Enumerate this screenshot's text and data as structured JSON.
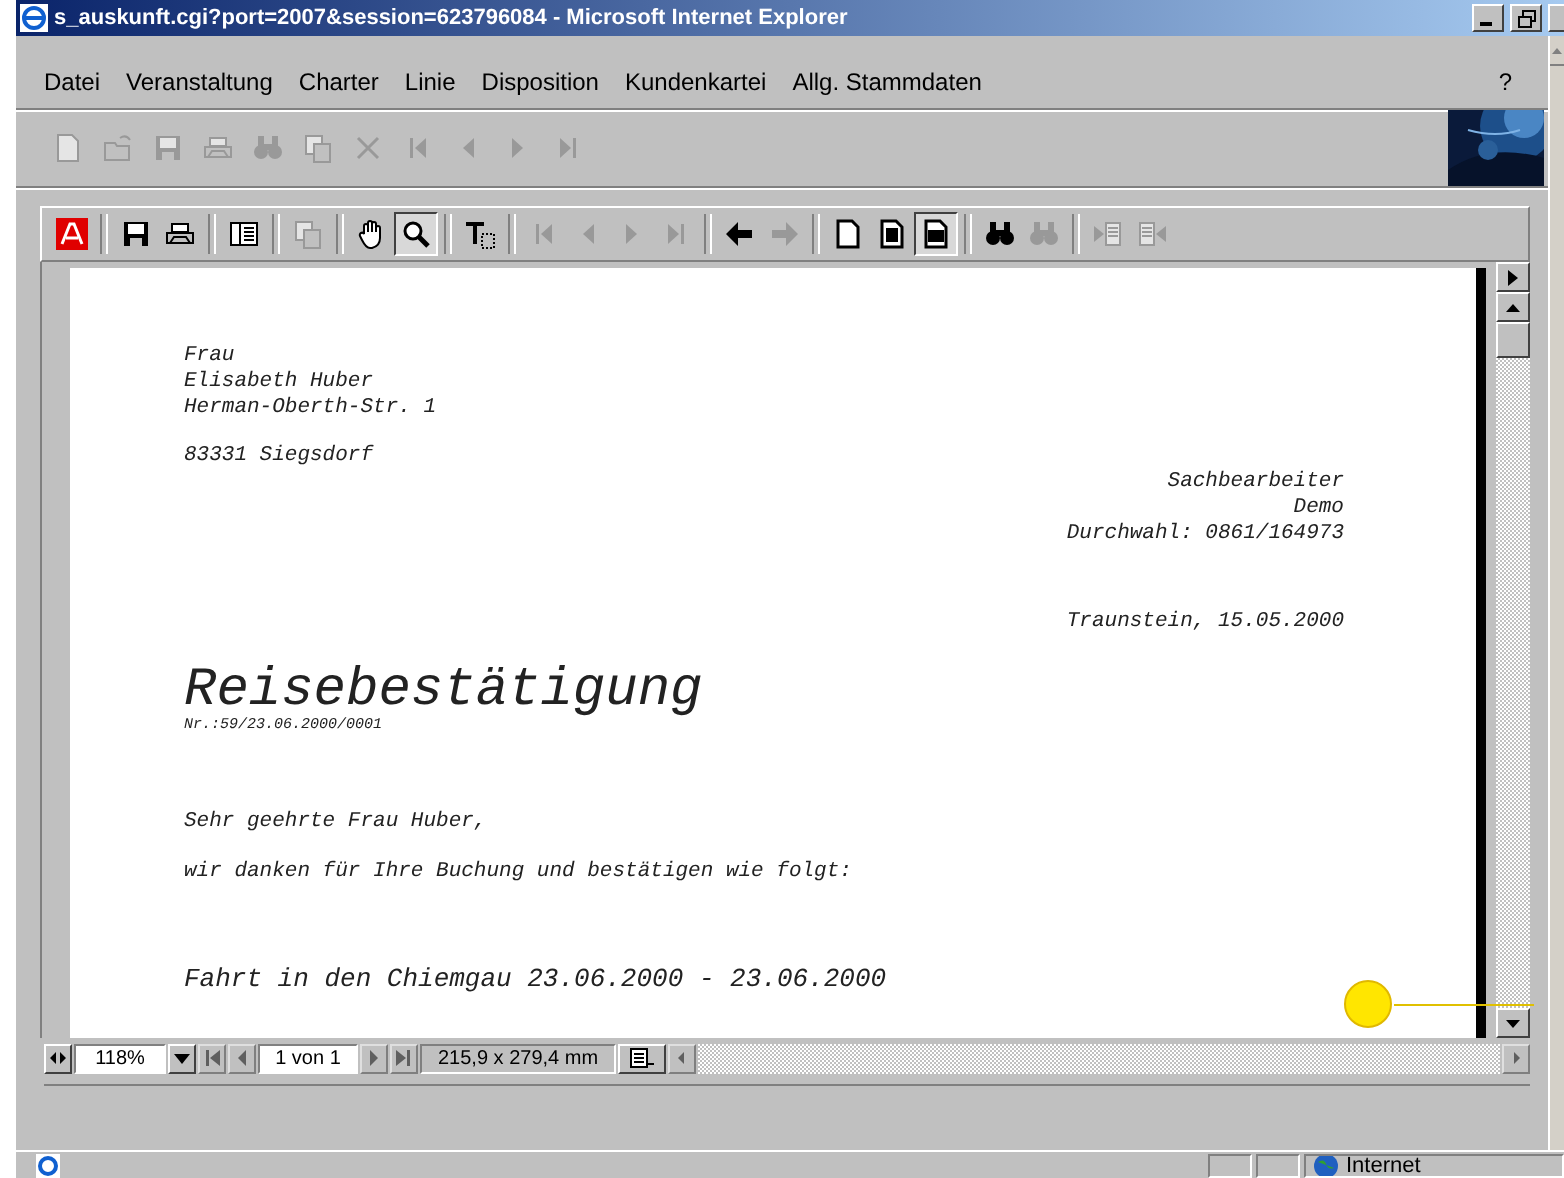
{
  "window": {
    "title": "s_auskunft.cgi?port=2007&session=623796084 - Microsoft Internet Explorer"
  },
  "menu": [
    "Datei",
    "Veranstaltung",
    "Charter",
    "Linie",
    "Disposition",
    "Kundenkartei",
    "Allg. Stammdaten"
  ],
  "help": "?",
  "toolbar": [
    {
      "kind": "new",
      "disabled": true
    },
    {
      "kind": "open",
      "disabled": true
    },
    {
      "kind": "save",
      "disabled": true
    },
    {
      "kind": "print",
      "disabled": true
    },
    {
      "kind": "find",
      "disabled": true
    },
    {
      "kind": "copy",
      "disabled": true
    },
    {
      "kind": "delete",
      "disabled": true
    },
    {
      "kind": "first",
      "disabled": true
    },
    {
      "kind": "prev",
      "disabled": true
    },
    {
      "kind": "next",
      "disabled": true
    },
    {
      "kind": "last",
      "disabled": true
    }
  ],
  "viewer_toolbar": [
    {
      "kind": "logo",
      "disabled": false,
      "selected": false
    },
    {
      "kind": "sep"
    },
    {
      "kind": "save",
      "disabled": false,
      "selected": false
    },
    {
      "kind": "print",
      "disabled": false,
      "selected": false
    },
    {
      "kind": "sep"
    },
    {
      "kind": "panel",
      "disabled": false,
      "selected": false
    },
    {
      "kind": "sep"
    },
    {
      "kind": "copy",
      "disabled": true,
      "selected": false
    },
    {
      "kind": "sep"
    },
    {
      "kind": "hand",
      "disabled": false,
      "selected": false
    },
    {
      "kind": "zoom",
      "disabled": false,
      "selected": true
    },
    {
      "kind": "sep"
    },
    {
      "kind": "text",
      "disabled": false,
      "selected": false
    },
    {
      "kind": "sep"
    },
    {
      "kind": "first",
      "disabled": true,
      "selected": false
    },
    {
      "kind": "prev",
      "disabled": true,
      "selected": false
    },
    {
      "kind": "next",
      "disabled": true,
      "selected": false
    },
    {
      "kind": "last",
      "disabled": true,
      "selected": false
    },
    {
      "kind": "sep"
    },
    {
      "kind": "back",
      "disabled": false,
      "selected": false
    },
    {
      "kind": "forward",
      "disabled": true,
      "selected": false
    },
    {
      "kind": "sep"
    },
    {
      "kind": "actual",
      "disabled": false,
      "selected": false
    },
    {
      "kind": "fitpage",
      "disabled": false,
      "selected": false
    },
    {
      "kind": "fitwidth",
      "disabled": false,
      "selected": true
    },
    {
      "kind": "sep"
    },
    {
      "kind": "find",
      "disabled": false,
      "selected": false
    },
    {
      "kind": "findweb",
      "disabled": true,
      "selected": false
    },
    {
      "kind": "sep"
    },
    {
      "kind": "docprev",
      "disabled": true,
      "selected": false
    },
    {
      "kind": "docnext",
      "disabled": true,
      "selected": false
    }
  ],
  "document": {
    "recipient": [
      "Frau",
      "Elisabeth Huber",
      "Herman-Oberth-Str. 1"
    ],
    "city": "83331 Siegsdorf",
    "clerk": [
      "Sachbearbeiter",
      "Demo",
      "Durchwahl: 0861/164973"
    ],
    "date": "Traunstein, 15.05.2000",
    "heading": "Reisebestätigung",
    "reference": "Nr.:59/23.06.2000/0001",
    "salutation": "Sehr geehrte Frau Huber,",
    "intro": "wir danken für Ihre Buchung und bestätigen wie folgt:",
    "trip": "Fahrt in den Chiemgau 23.06.2000 - 23.06.2000"
  },
  "viewer_status": {
    "zoom": "118%",
    "page": "1 von 1",
    "page_size": "215,9 x 279,4 mm"
  },
  "status_bar": {
    "zone": "Internet"
  }
}
